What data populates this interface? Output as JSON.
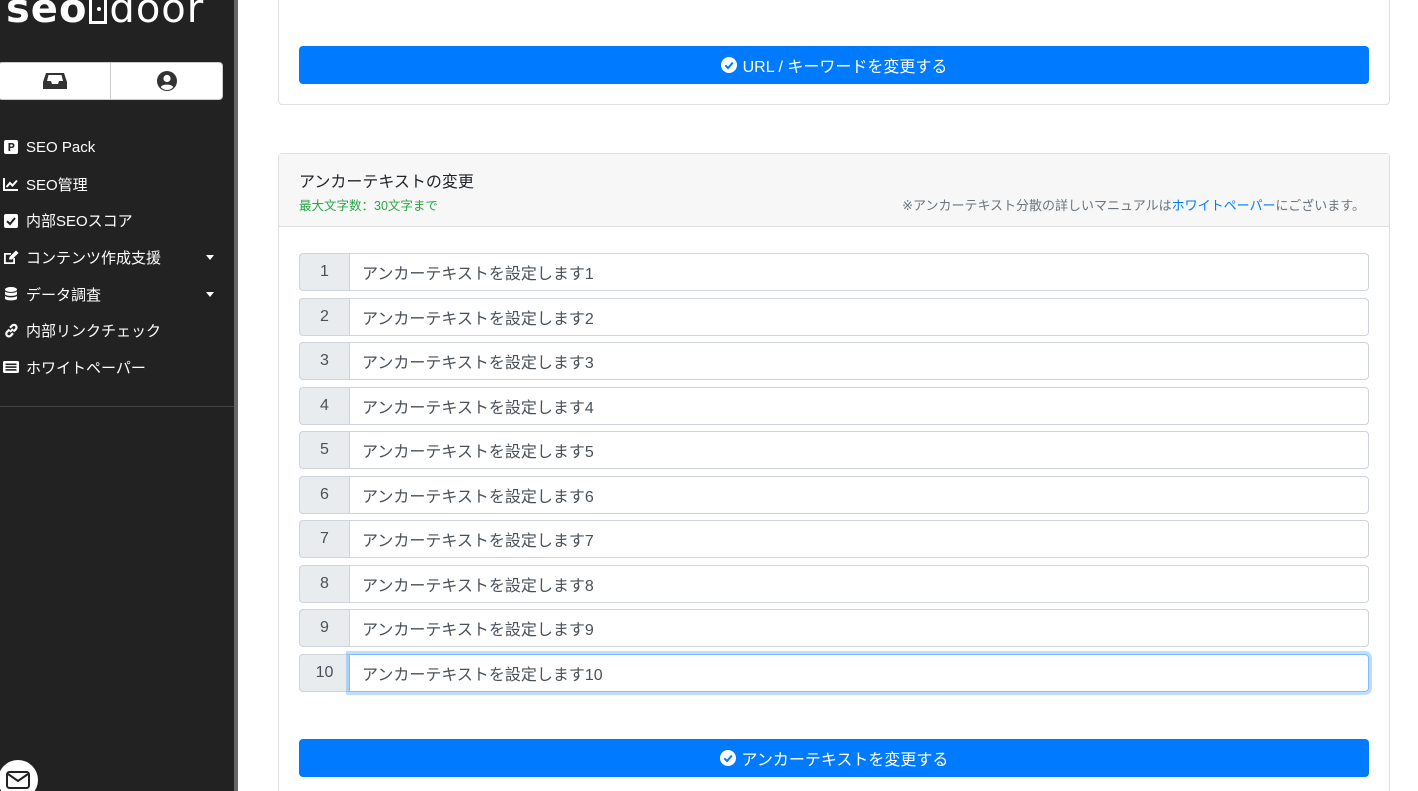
{
  "sidebar": {
    "logo_left": "seo",
    "logo_right": "door",
    "nav": [
      {
        "label": "SEO Pack",
        "icon": "p-square-icon",
        "has_caret": false
      },
      {
        "label": "SEO管理",
        "icon": "line-chart-icon",
        "has_caret": false
      },
      {
        "label": "内部SEOスコア",
        "icon": "check-square-icon",
        "has_caret": false
      },
      {
        "label": "コンテンツ作成支援",
        "icon": "edit-icon",
        "has_caret": true
      },
      {
        "label": "データ調査",
        "icon": "database-icon",
        "has_caret": true
      },
      {
        "label": "内部リンクチェック",
        "icon": "link-icon",
        "has_caret": false
      },
      {
        "label": "ホワイトペーパー",
        "icon": "newspaper-icon",
        "has_caret": false
      }
    ]
  },
  "top_card": {
    "button_label": "URL / キーワードを変更する"
  },
  "anchor_card": {
    "title": "アンカーテキストの変更",
    "max_chars": "最大文字数：30文字まで",
    "note_prefix": "※アンカーテキスト分散の詳しいマニュアルは",
    "note_link": "ホワイトペーパー",
    "note_suffix": "にございます。",
    "rows": [
      {
        "num": "1",
        "value": "アンカーテキストを設定します1"
      },
      {
        "num": "2",
        "value": "アンカーテキストを設定します2"
      },
      {
        "num": "3",
        "value": "アンカーテキストを設定します3"
      },
      {
        "num": "4",
        "value": "アンカーテキストを設定します4"
      },
      {
        "num": "5",
        "value": "アンカーテキストを設定します5"
      },
      {
        "num": "6",
        "value": "アンカーテキストを設定します6"
      },
      {
        "num": "7",
        "value": "アンカーテキストを設定します7"
      },
      {
        "num": "8",
        "value": "アンカーテキストを設定します8"
      },
      {
        "num": "9",
        "value": "アンカーテキストを設定します9"
      },
      {
        "num": "10",
        "value": "アンカーテキストを設定します10"
      }
    ],
    "submit_label": "アンカーテキストを変更する"
  },
  "colors": {
    "primary": "#007bff",
    "sidebar_bg": "#222222",
    "success_text": "#28a745"
  }
}
